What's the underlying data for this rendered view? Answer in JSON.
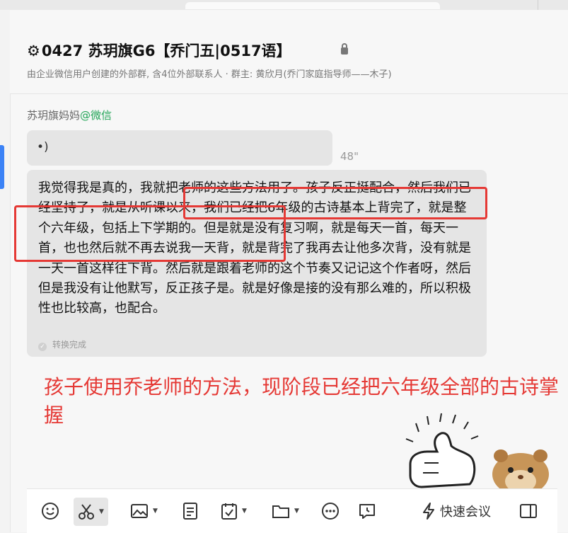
{
  "chat": {
    "title": "0427 苏玥旗G6【乔门五|0517语】",
    "subtitle": "由企业微信用户创建的外部群, 含4位外部联系人 · 群主: 黄欣月(乔门家庭指导师——木子)"
  },
  "message": {
    "sender_name": "苏玥旗妈妈",
    "sender_tag": "@微信",
    "voice_duration": "48\"",
    "transcript": "我觉得我是真的，我就把老师的这些方法用了。孩子反正挺配合，然后我们已经坚持了，就是从听课以来，我们已经把6年级的古诗基本上背完了，就是整个六年级，包括上下学期的。但是就是没有复习啊，就是每天一首，每天一首，也也然后就不再去说我一天背，就是背完了我再去让他多次背，没有就是一天一首这样往下背。然后就是跟着老师的这个节奏又记记这个作者呀，然后但是我没有让他默写，反正孩子是。就是好像是接的没有那么难的，所以积极性也比较高，也配合。",
    "convert_status": "转换完成"
  },
  "annotation": {
    "note": "孩子使用乔老师的方法，现阶段已经把六年级全部的古诗掌握",
    "highlight_color": "#e53935"
  },
  "toolbar": {
    "items": [
      "emoji-icon",
      "scissors-icon",
      "image-icon",
      "document-icon",
      "calendar-check-icon",
      "folder-icon",
      "more-icon",
      "chat-history-icon",
      "lightning-icon",
      "sidebar-icon"
    ],
    "meeting_label": "快速会议"
  },
  "colors": {
    "accent_blue": "#3b82f6",
    "wechat_green": "#21a456",
    "bubble_bg": "#e5e5e5"
  }
}
